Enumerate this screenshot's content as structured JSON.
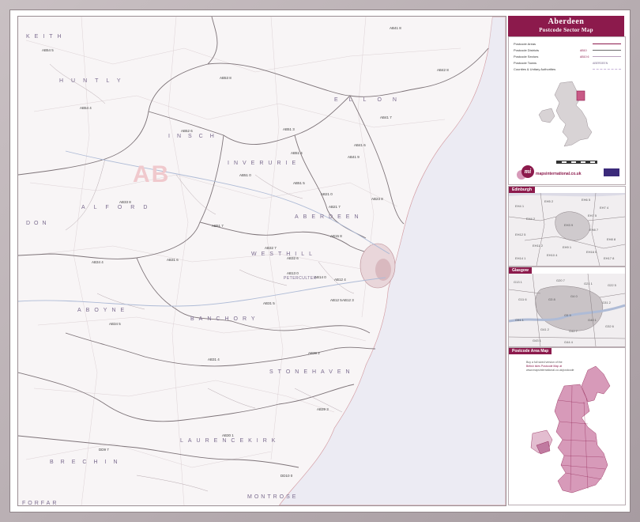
{
  "title": {
    "main": "Aberdeen",
    "sub": "Postcode Sector Map"
  },
  "legend": {
    "rows": [
      {
        "label": "Postcode Areas",
        "example": "",
        "line_color": "#8c1a4c"
      },
      {
        "label": "Postcode Districts",
        "example": "AB10",
        "line_color": "#6b6b6b"
      },
      {
        "label": "Postcode Sectors",
        "example": "AB10 6",
        "line_color": "#b9a2bd"
      },
      {
        "label": "Postcode Towns",
        "example": "ABERDEEN",
        "line_color": ""
      },
      {
        "label": "Counties & Unitary Authorities",
        "example": "",
        "line_color": "#c7b3d9"
      }
    ],
    "brand": "mapsinternational.co.uk",
    "logo_text": "mi"
  },
  "map": {
    "area_label": "AB",
    "towns": [
      {
        "label": "KEITH"
      },
      {
        "label": "HUNTLY"
      },
      {
        "label": "ELLON"
      },
      {
        "label": "INSCH"
      },
      {
        "label": "INVERURIE"
      },
      {
        "label": "ALFORD"
      },
      {
        "label": "ABERDEEN"
      },
      {
        "label": "WESTHILL"
      },
      {
        "label": "PETERCULTER"
      },
      {
        "label": "DON"
      },
      {
        "label": "ABOYNE"
      },
      {
        "label": "BANCHORY"
      },
      {
        "label": "STONEHAVEN"
      },
      {
        "label": "LAURENCEKIRK"
      },
      {
        "label": "BRECHIN"
      },
      {
        "label": "MONTROSE"
      },
      {
        "label": "FORFAR"
      }
    ],
    "sectors": [
      "AB54 5",
      "AB41 8",
      "AB42 8",
      "AB53 8",
      "AB54 4",
      "AB52 6",
      "AB41 7",
      "AB41 6",
      "AB51 3",
      "AB51 4",
      "AB51 0",
      "AB51 5",
      "AB21 0",
      "AB21 7",
      "AB23 8",
      "AB33 8",
      "AB51 7",
      "AB32 7",
      "AB32 6",
      "AB15 8",
      "AB14 0",
      "AB13 0",
      "AB12 4",
      "AB12 5",
      "AB31 5",
      "AB31 6",
      "AB34 4",
      "AB34 5",
      "AB39 2",
      "AB39 3",
      "AB31 4",
      "AB30 1",
      "DD9 7",
      "DD10 0",
      "AB12 3",
      "AB41 9"
    ]
  },
  "insets": {
    "edinburgh": {
      "tag": "Edinburgh",
      "labels": [
        "EH4 1",
        "EH5 2",
        "EH7 4",
        "EH6 5",
        "EH4 2",
        "EH12 5",
        "EH3 9",
        "EH8 7",
        "EH11 2",
        "EH9 1",
        "EH10 4",
        "EH16 5",
        "EH14 1",
        "EH17 8",
        "EH8 8",
        "EH7 5"
      ]
    },
    "glasgow": {
      "tag": "Glasgow",
      "labels": [
        "G13 1",
        "G20 7",
        "G21 1",
        "G22 5",
        "G11 6",
        "G3 8",
        "G4 0",
        "G31 2",
        "G51 1",
        "G5 9",
        "G41 2",
        "G42 7",
        "G43 1",
        "G44 4",
        "G32 6",
        "G40 1"
      ]
    },
    "area_map": {
      "tag": "Postcode Area Map",
      "note_1": "Buy a full sized version of the",
      "note_2": "British Isles Postcode Map at",
      "note_3": "www.mapsinternational.co.uk/postcode"
    }
  },
  "colors": {
    "brand": "#8c1a4c",
    "area_fill": "#d79ab9",
    "water": "#ecebf3"
  }
}
